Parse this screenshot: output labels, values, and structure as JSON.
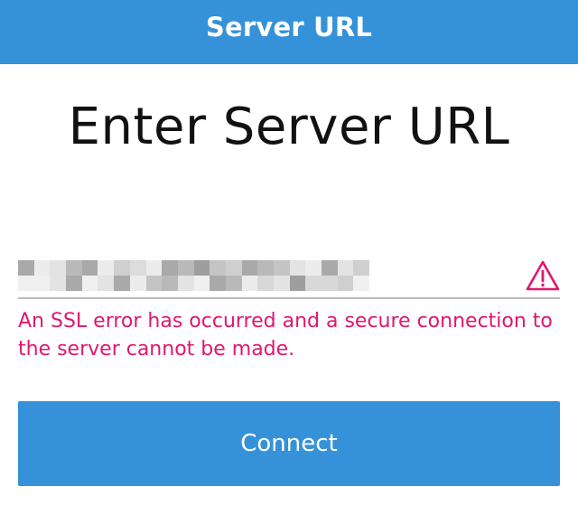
{
  "header": {
    "title": "Server URL"
  },
  "main": {
    "heading": "Enter Server URL",
    "url_field": {
      "value_obscured": true
    },
    "error_message": "An SSL error has occurred and a secure connection to the server cannot be made.",
    "connect_button_label": "Connect"
  },
  "icons": {
    "field_status": "warning-triangle-icon"
  },
  "colors": {
    "primary": "#3592d8",
    "error": "#e0176f",
    "text": "#111111",
    "field_underline": "#bdbdbd"
  }
}
